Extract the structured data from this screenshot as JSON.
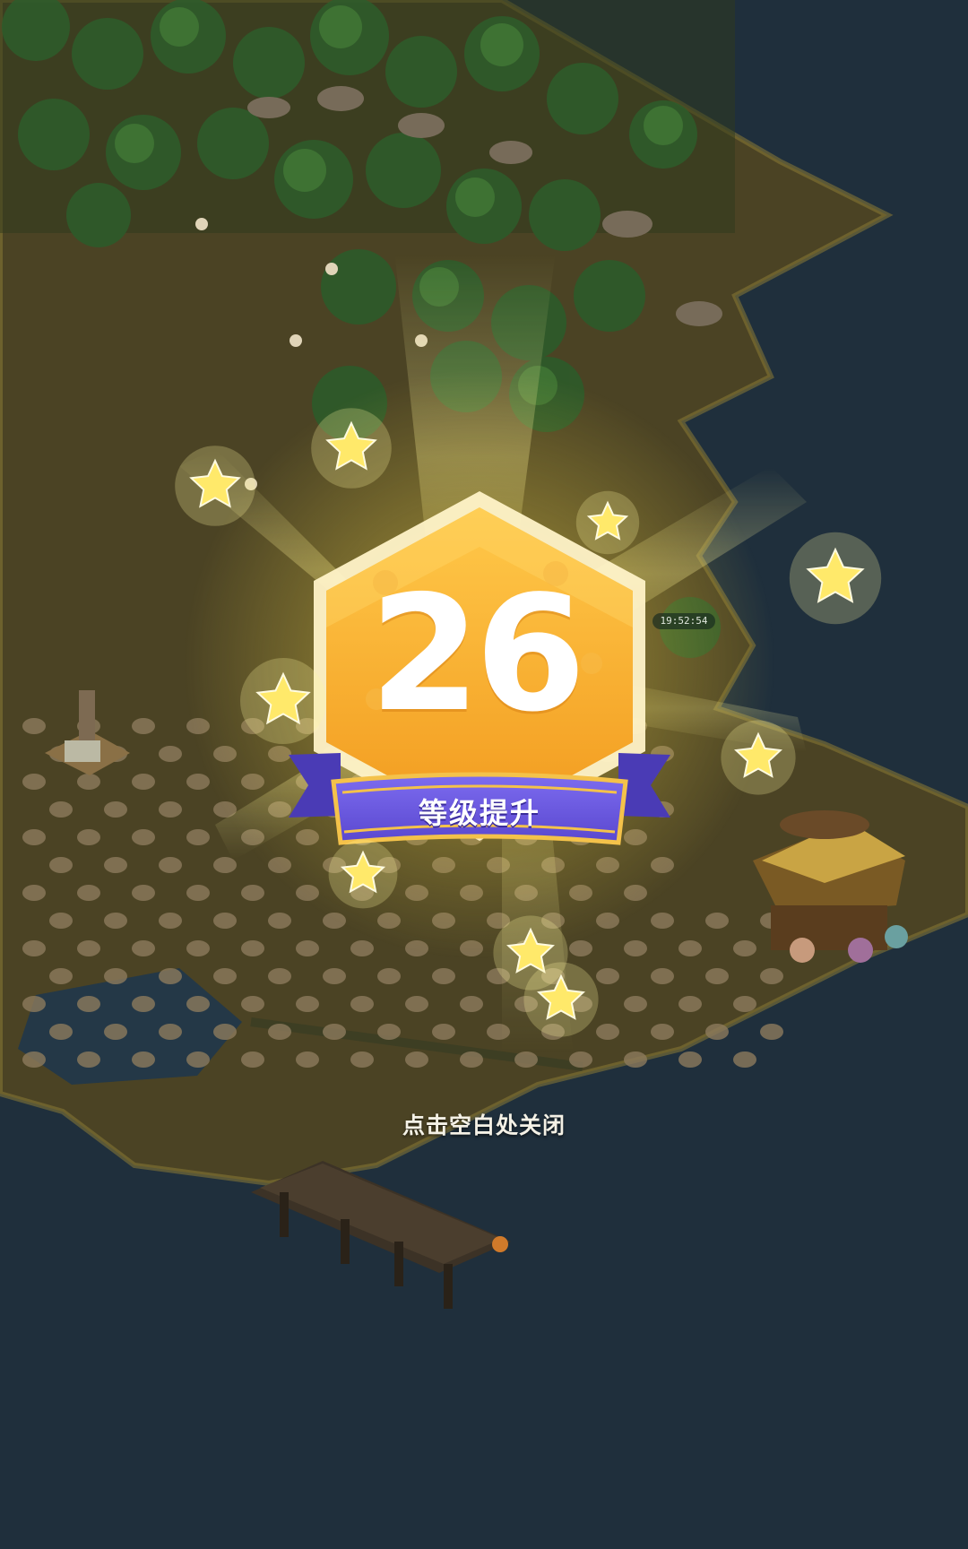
{
  "level_up": {
    "level": "26",
    "title": "等级提升"
  },
  "hint": "点击空白处关闭",
  "timer": "19:52:54",
  "colors": {
    "sea": "#1f2f3c",
    "sand": "#4a4122",
    "badge_gold": "#f7a928",
    "ribbon_purple": "#6b5ce0",
    "star": "#ffe96a"
  }
}
